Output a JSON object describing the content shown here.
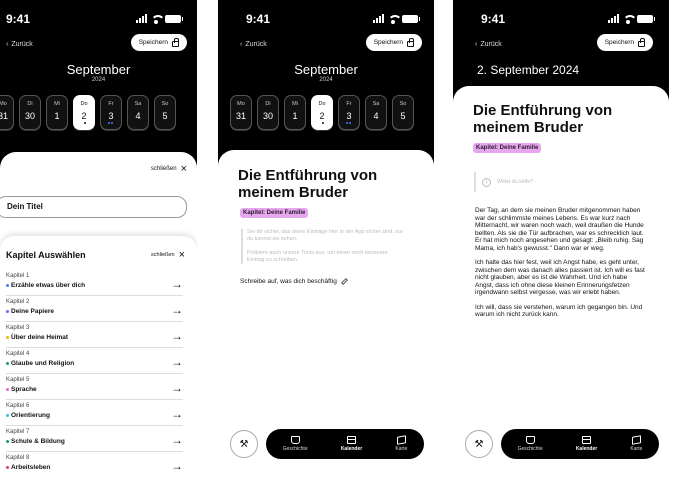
{
  "status": {
    "time": "9:41"
  },
  "header": {
    "back_label": "Zurück",
    "save_label": "Speichern",
    "month": "September",
    "year": "2024",
    "full_date": "2. September 2024"
  },
  "days": [
    {
      "name": "Mo",
      "date": "31"
    },
    {
      "name": "Di",
      "date": "30"
    },
    {
      "name": "Mi",
      "date": "1"
    },
    {
      "name": "Do",
      "date": "2"
    },
    {
      "name": "Fr",
      "date": "3"
    },
    {
      "name": "Sa",
      "date": "4"
    },
    {
      "name": "So",
      "date": "5"
    }
  ],
  "title_sheet": {
    "close_label": "schließen",
    "title_value": "Dein Titel"
  },
  "chapter_panel": {
    "title": "Kapitel Auswählen",
    "close_label": "schließen",
    "chapters": [
      {
        "number": "Kapitel 1",
        "title": "Erzähle etwas über dich",
        "color": "#4a7bff"
      },
      {
        "number": "Kapitel 2",
        "title": "Deine Papiere",
        "color": "#8b5cf6"
      },
      {
        "number": "Kapitel 3",
        "title": "Über deine Heimat",
        "color": "#f5b400"
      },
      {
        "number": "Kapitel 4",
        "title": "Glaube und Religion",
        "color": "#22a06b"
      },
      {
        "number": "Kapitel 5",
        "title": "Sprache",
        "color": "#e86ad8"
      },
      {
        "number": "Kapitel 6",
        "title": "Orientierung",
        "color": "#36c5d8"
      },
      {
        "number": "Kapitel 7",
        "title": "Schule & Bildung",
        "color": "#22a06b"
      },
      {
        "number": "Kapitel 8",
        "title": "Arbeitsleben",
        "color": "#e0455a"
      }
    ]
  },
  "entry": {
    "title": "Die Entführung von meinem Bruder",
    "chapter_tag": "Kapitel: Deine Familie",
    "tag_color": "#e6a7ee",
    "hint_1": "Sei dir sicher, das deine Einträge hier in der App sicher sind, nur du kannst sie sehen.",
    "hint_2": "Probiere auch unsere Tools aus, um einen noch besseren Eintrag zu schreiben.",
    "write_prompt": "Schreibe auf, was dich beschäftig",
    "help_prompt": "Willst du Hilfe?",
    "paragraph_1": "Der Tag, an dem sie meinen Bruder mitgenommen haben war der schlimmste meines Lebens. Es war kurz nach Mitternacht, wir waren noch wach, weil draußen die Hunde bellten. Als sie die Tür aufbrachen, war es schrecklich laut. Er hat mich noch angesehen und gesagt: „Bleib ruhig. Sag Mama, ich hab's gewusst.\" Dann war er weg.",
    "paragraph_2": "Ich halte das hier fest, weil ich Angst habe, es geht unter, zwischen dem was danach alles passiert ist. Ich will es fast nicht glauben, aber es ist die Wahrheit. Und ich habe Angst, dass ich ohne diese kleinen Erinnerungsfetzen irgendwann selbst vergesse, was wir erlebt haben.",
    "paragraph_3": "Ich will, dass sie verstehen, warum ich gegangen bin. Und warum ich nicht zurück kann."
  },
  "nav": {
    "stories_label": "Geschichte",
    "calendar_label": "Kalender",
    "map_label": "Karte"
  }
}
